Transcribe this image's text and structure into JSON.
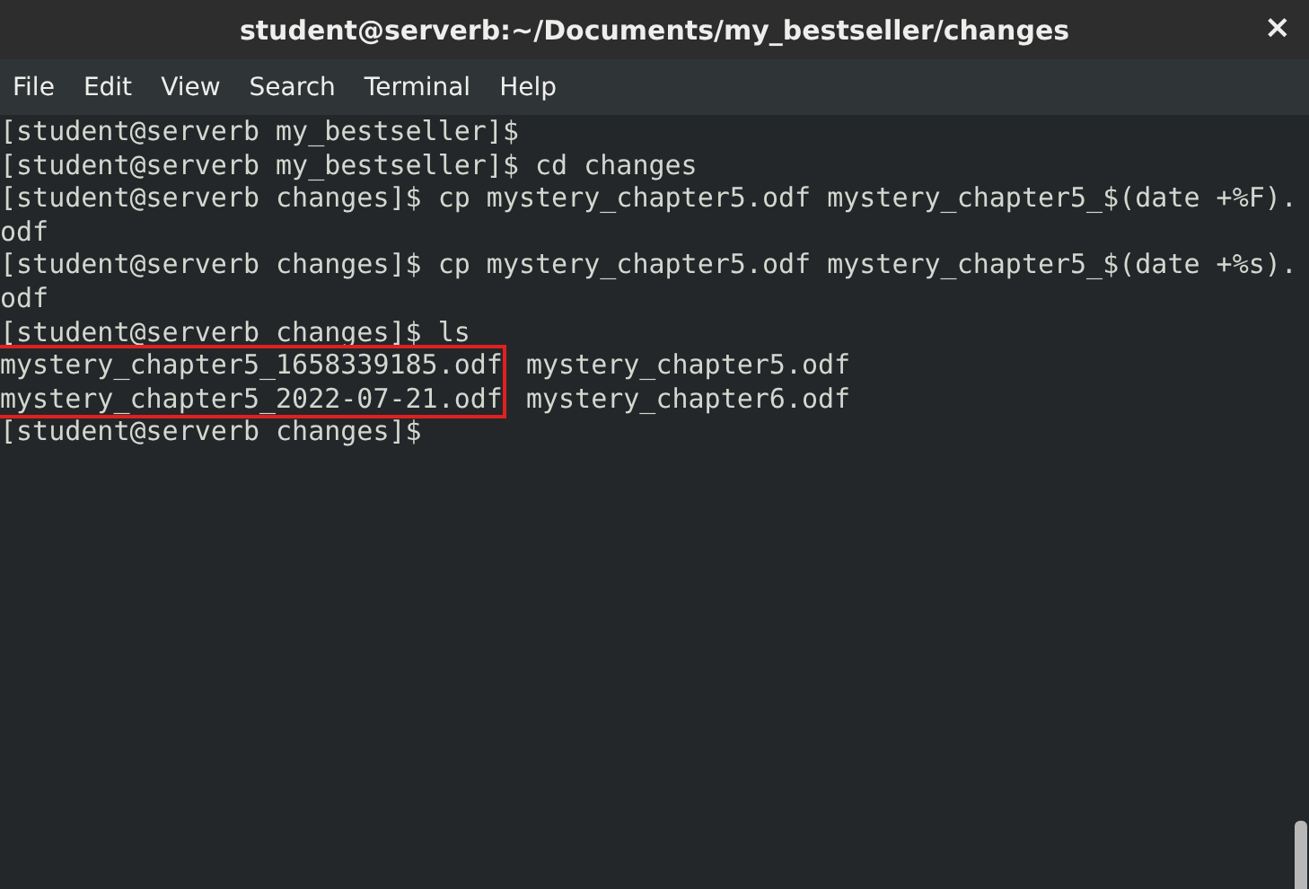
{
  "window": {
    "title": "student@serverb:~/Documents/my_bestseller/changes",
    "close": "×"
  },
  "menu": [
    "File",
    "Edit",
    "View",
    "Search",
    "Terminal",
    "Help"
  ],
  "terminal": {
    "lines": [
      {
        "kind": "text",
        "text": "[student@serverb my_bestseller]$"
      },
      {
        "kind": "text",
        "text": "[student@serverb my_bestseller]$ cd changes"
      },
      {
        "kind": "text",
        "text": "[student@serverb changes]$ cp mystery_chapter5.odf mystery_chapter5_$(date +%F)."
      },
      {
        "kind": "text",
        "text": "odf"
      },
      {
        "kind": "text",
        "text": "[student@serverb changes]$ cp mystery_chapter5.odf mystery_chapter5_$(date +%s)."
      },
      {
        "kind": "text",
        "text": "odf"
      },
      {
        "kind": "text",
        "text": "[student@serverb changes]$ ls"
      },
      {
        "kind": "listing",
        "columns": [
          {
            "highlighted": true,
            "files": [
              "mystery_chapter5_1658339185.odf",
              "mystery_chapter5_2022-07-21.odf"
            ]
          },
          {
            "highlighted": false,
            "files": [
              "mystery_chapter5.odf",
              "mystery_chapter6.odf"
            ]
          }
        ]
      },
      {
        "kind": "text",
        "text": "[student@serverb changes]$"
      }
    ]
  }
}
